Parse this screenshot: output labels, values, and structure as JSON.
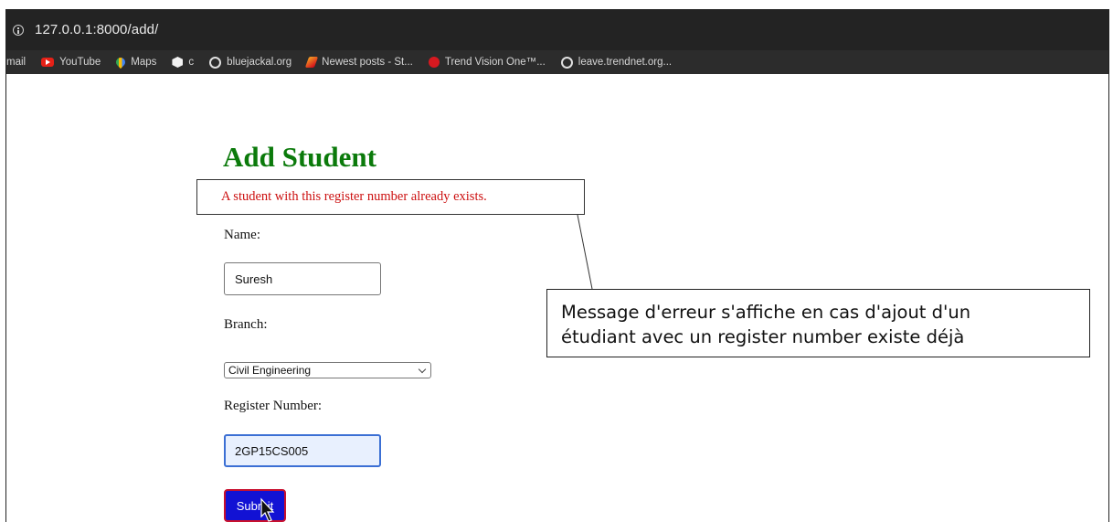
{
  "browser": {
    "url": "127.0.0.1:8000/add/",
    "bookmarks": [
      {
        "label": "mail",
        "icon": "none"
      },
      {
        "label": "YouTube",
        "icon": "youtube-icon"
      },
      {
        "label": "Maps",
        "icon": "maps-icon"
      },
      {
        "label": "c",
        "icon": "hexagon-icon"
      },
      {
        "label": "bluejackal.org",
        "icon": "globe-icon"
      },
      {
        "label": "Newest posts - St...",
        "icon": "pen-icon"
      },
      {
        "label": "Trend Vision One™...",
        "icon": "trend-icon"
      },
      {
        "label": "leave.trendnet.org...",
        "icon": "globe-icon"
      }
    ]
  },
  "form": {
    "title": "Add Student",
    "error": "A student with this register number already exists.",
    "name_label": "Name:",
    "name_value": "Suresh",
    "branch_label": "Branch:",
    "branch_value": "Civil Engineering",
    "register_label": "Register Number:",
    "register_value": "2GP15CS005",
    "submit_label": "Submit"
  },
  "annotation": {
    "line1": "Message d'erreur s'affiche en cas d'ajout d'un",
    "line2": "étudiant avec un register number existe déjà"
  },
  "colors": {
    "title": "#0b7a0b",
    "error_text": "#cc1010",
    "submit_bg": "#1212d4",
    "submit_border": "#c8102e"
  }
}
